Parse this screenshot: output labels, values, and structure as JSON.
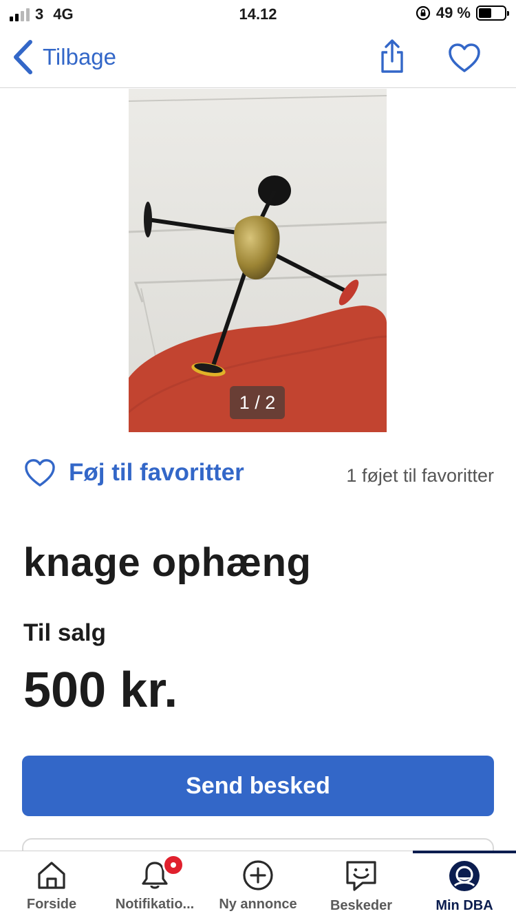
{
  "status_bar": {
    "carrier": "3",
    "network": "4G",
    "time": "14.12",
    "battery": "49 %",
    "battery_level": 0.49,
    "signal_bars": 4,
    "signal_active": 2
  },
  "nav": {
    "back_label": "Tilbage"
  },
  "gallery": {
    "counter": "1 / 2",
    "current_image": 1,
    "total_images": 2
  },
  "favorites": {
    "add_label": "Føj til favoritter",
    "count_text": "1 føjet til favoritter"
  },
  "listing": {
    "title": "knage ophæng",
    "sale_type": "Til salg",
    "price": "500 kr."
  },
  "actions": {
    "send_message": "Send besked"
  },
  "tabbar": {
    "items": [
      {
        "label": "Forside",
        "icon": "home-icon"
      },
      {
        "label": "Notifikatio...",
        "icon": "bell-icon",
        "has_badge": true
      },
      {
        "label": "Ny annonce",
        "icon": "plus-circle-icon"
      },
      {
        "label": "Beskeder",
        "icon": "chat-icon"
      },
      {
        "label": "Min DBA",
        "icon": "profile-icon",
        "active": true
      }
    ]
  },
  "colors": {
    "accent": "#3367c8",
    "active_tab": "#0b1d4f",
    "badge": "#e0202d"
  }
}
